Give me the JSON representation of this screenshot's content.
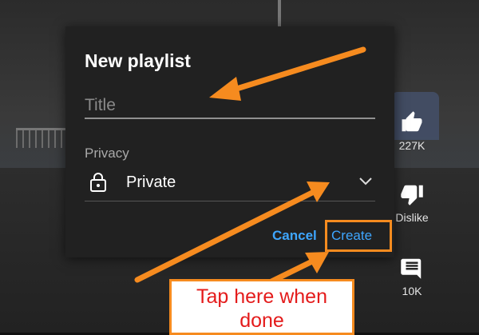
{
  "dialog": {
    "title": "New playlist",
    "title_field_placeholder": "Title",
    "privacy_label": "Privacy",
    "privacy_value": "Private",
    "cancel_label": "Cancel",
    "create_label": "Create"
  },
  "side_actions": {
    "like_count": "227K",
    "dislike_label": "Dislike",
    "comments_count": "10K"
  },
  "annotation": {
    "callout_text": "Tap here when done",
    "color": "#f68b1f",
    "text_color": "#e41b1b"
  },
  "colors": {
    "accent_blue": "#3ea6ff",
    "dialog_bg": "#212121"
  }
}
